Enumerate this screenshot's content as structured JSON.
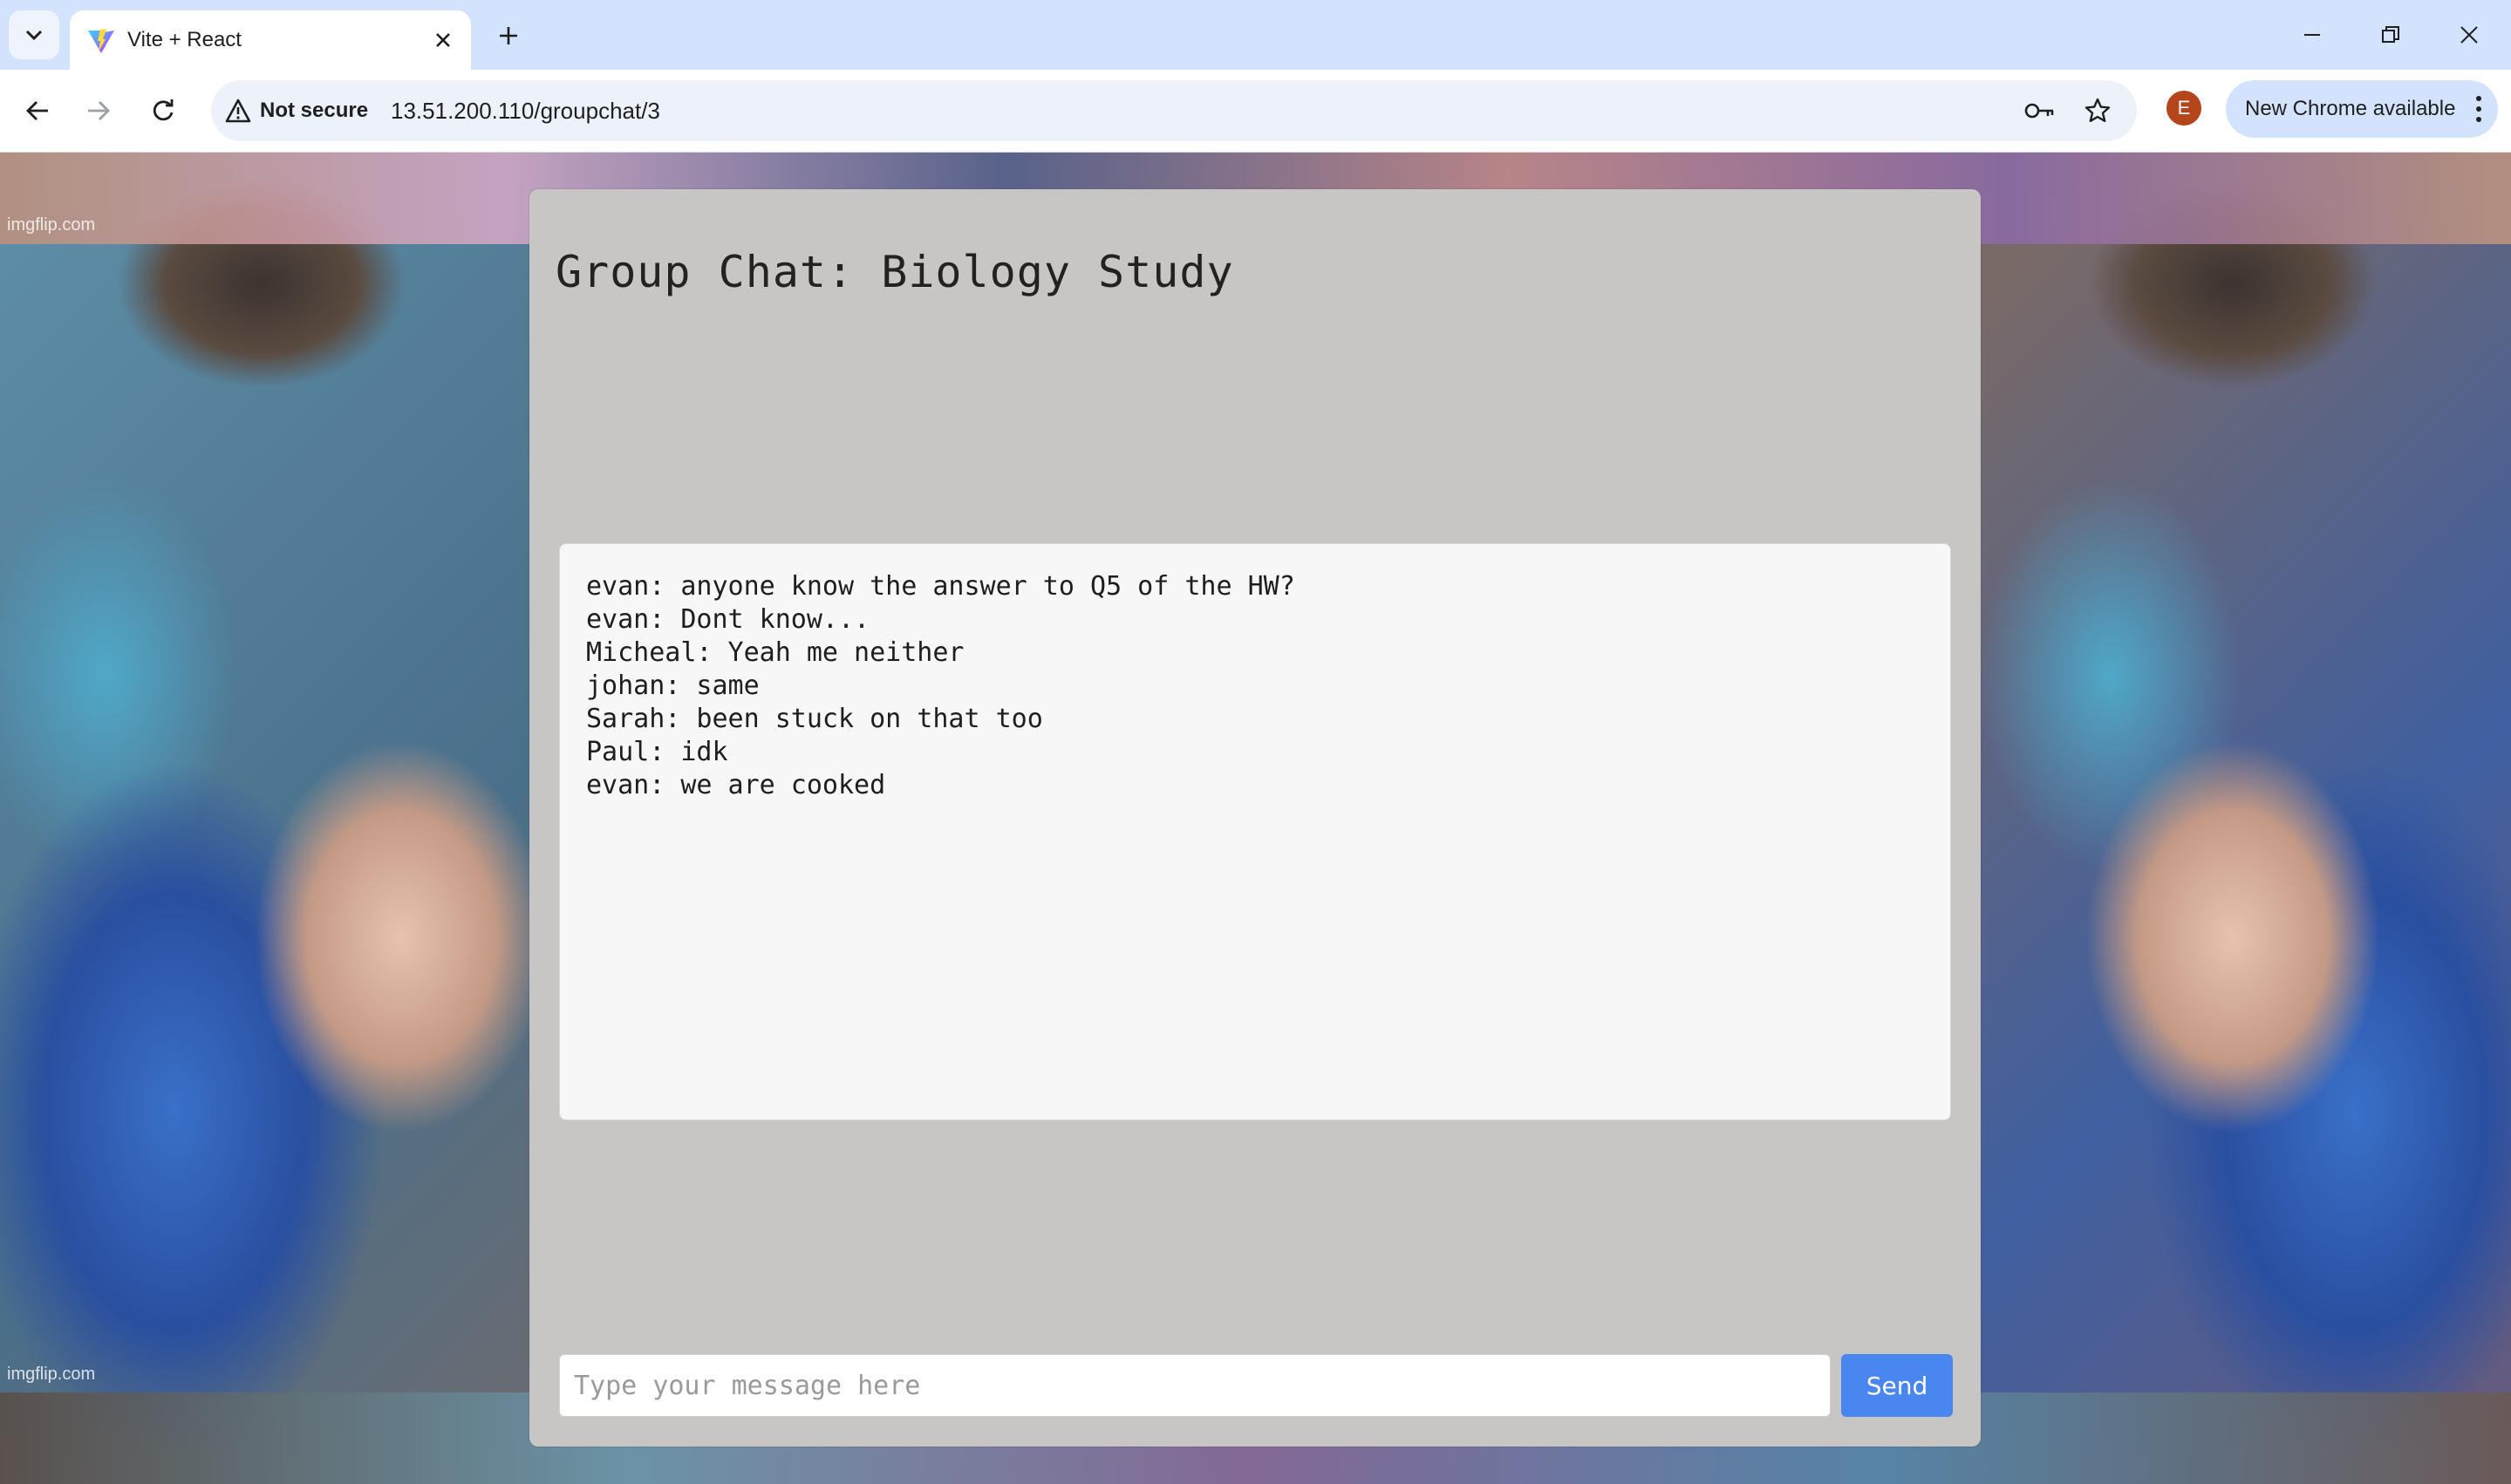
{
  "browser": {
    "tab": {
      "title": "Vite + React"
    },
    "address": {
      "security_label": "Not secure",
      "url": "13.51.200.110/groupchat/3"
    },
    "profile_initial": "E",
    "update_label": "New Chrome available"
  },
  "background": {
    "watermark_top": "imgflip.com",
    "watermark_bottom": "imgflip.com"
  },
  "chat": {
    "title": "Group Chat: Biology Study",
    "messages": [
      "evan: anyone know the answer to Q5 of the HW?",
      "evan: Dont know...",
      "Micheal: Yeah me neither",
      "johan: same",
      "Sarah: been stuck on that too",
      "Paul: idk",
      "evan: we are cooked"
    ],
    "input_placeholder": "Type your message here",
    "send_label": "Send"
  },
  "colors": {
    "card": "#c8c6c4",
    "send_button": "#4a86f0",
    "tabstrip": "#d3e3fd"
  }
}
